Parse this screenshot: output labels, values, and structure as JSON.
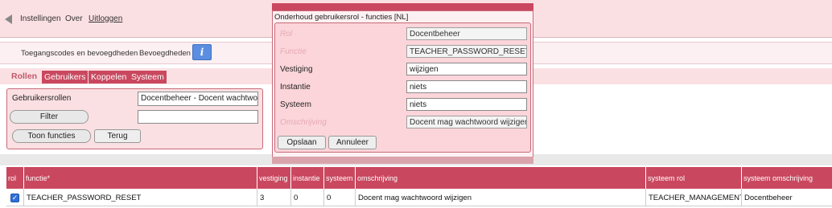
{
  "nav": {
    "links": [
      "Instellingen",
      "Over",
      "Uitloggen"
    ]
  },
  "breadcrumb": {
    "items": [
      "Toegangscodes en bevoegdheden",
      "Bevoegdheden"
    ],
    "info_glyph": "i"
  },
  "tabs": {
    "active": "Rollen",
    "items": [
      "Gebruikers",
      "Koppelen",
      "Systeem"
    ]
  },
  "filter": {
    "label": "Gebruikersrollen",
    "select_value": "Docentbeheer - Docent wachtwoord",
    "filter_button": "Filter",
    "filter_value": "",
    "show_functions_button": "Toon functies",
    "back_button": "Terug"
  },
  "table": {
    "columns": [
      "rol",
      "functie*",
      "vestiging",
      "instantie",
      "systeem",
      "omschrijving",
      "systeem rol",
      "systeem omschrijving"
    ],
    "rows": [
      {
        "checked": true,
        "functie": "TEACHER_PASSWORD_RESET",
        "vestiging": "3",
        "instantie": "0",
        "systeem": "0",
        "omschrijving": "Docent mag wachtwoord wijzigen",
        "systeem_rol": "TEACHER_MANAGEMENT",
        "systeem_omschrijving": "Docentbeheer"
      }
    ]
  },
  "modal": {
    "title": "Onderhoud gebruikersrol - functies [NL]",
    "fields": {
      "rol": {
        "label": "Rol",
        "value": "Docentbeheer"
      },
      "functie": {
        "label": "Functie",
        "value": "TEACHER_PASSWORD_RESET"
      },
      "vestiging": {
        "label": "Vestiging",
        "value": "wijzigen"
      },
      "instantie": {
        "label": "Instantie",
        "value": "niets"
      },
      "systeem": {
        "label": "Systeem",
        "value": "niets"
      },
      "omschrijving": {
        "label": "Omschrijving",
        "value": "Docent mag wachtwoord wijzigen"
      }
    },
    "save_button": "Opslaan",
    "cancel_button": "Annuleer"
  },
  "colors": {
    "accent": "#c9485f",
    "panel": "#fbe0e3",
    "readonly_label": "#e8a9b4",
    "checkbox": "#2f6fd6"
  },
  "icons": {
    "back": "back-arrow-icon",
    "info": "info-icon",
    "check": "checkbox-checked-icon"
  }
}
